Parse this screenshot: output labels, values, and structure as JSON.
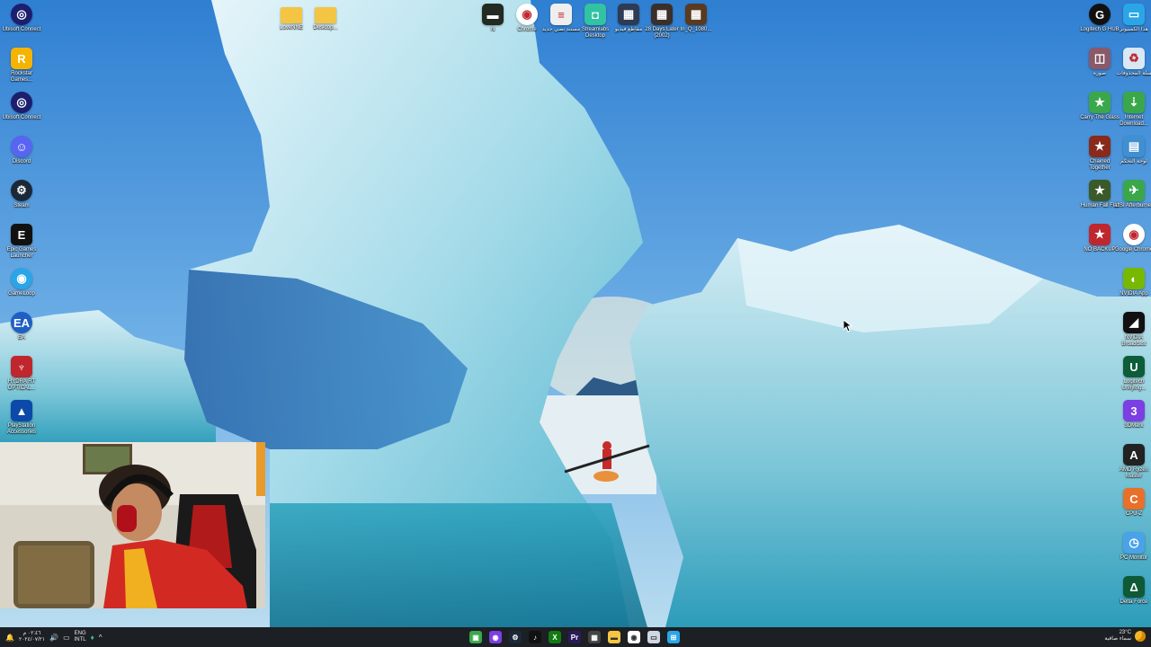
{
  "desktop": {
    "left_icons": [
      {
        "label": "Ubisoft Connect",
        "icon": "ubisoft-icon",
        "color": "#1b1f6e"
      },
      {
        "label": "Rockstar Games...",
        "icon": "rockstar-icon",
        "color": "#f4b400"
      },
      {
        "label": "Ubisoft Connect",
        "icon": "ubisoft-icon",
        "color": "#1b1f6e"
      },
      {
        "label": "Discord",
        "icon": "discord-icon",
        "color": "#5865f2"
      },
      {
        "label": "Steam",
        "icon": "steam-icon",
        "color": "#1b2838"
      },
      {
        "label": "Epic Games Launcher",
        "icon": "epic-games-icon",
        "color": "#111111"
      },
      {
        "label": "GameLoop",
        "icon": "gameloop-icon",
        "color": "#2aa6e8"
      },
      {
        "label": "EA",
        "icon": "ea-icon",
        "color": "#1f5fc4"
      },
      {
        "label": "HYDRA RT OPTICAL...",
        "icon": "hydra-icon",
        "color": "#c0262d"
      },
      {
        "label": "PlayStation Accessories",
        "icon": "playstation-icon",
        "color": "#0b4aa8"
      }
    ],
    "top_icons": [
      {
        "label": "LoveNNE",
        "icon": "folder-icon",
        "color": "#f4c542"
      },
      {
        "label": "Desktop...",
        "icon": "folder-icon",
        "color": "#f4c542"
      },
      {
        "label": "N",
        "icon": "battery-file-icon",
        "color": "#222a22"
      },
      {
        "label": "Chrome",
        "icon": "chrome-icon",
        "color": "#ffffff"
      },
      {
        "label": "مستند نصي جديد",
        "icon": "text-file-icon",
        "color": "#eeeeee"
      },
      {
        "label": "Streamlabs Desktop",
        "icon": "streamlabs-icon",
        "color": "#31c3a2"
      },
      {
        "label": "مقاطع فيديو",
        "icon": "video-file-icon",
        "color": "#2d3b55"
      },
      {
        "label": "28 Days Later (2002)",
        "icon": "video-file-icon",
        "color": "#3a2f2a"
      },
      {
        "label": "In_Q_1080...",
        "icon": "video-file-icon",
        "color": "#5a3b1f"
      }
    ],
    "right_col_outer": [
      {
        "label": "هذا الكمبيوتر",
        "icon": "monitor-icon",
        "color": "#2aa6e8"
      },
      {
        "label": "سلة المحذوفات",
        "icon": "recycle-bin-icon",
        "color": "#d8e8f5"
      },
      {
        "label": "Internet Download...",
        "icon": "idm-icon",
        "color": "#3aa84a"
      },
      {
        "label": "لوحة التحكم",
        "icon": "control-panel-icon",
        "color": "#3f8fd1"
      },
      {
        "label": "MSI Afterburner",
        "icon": "afterburner-icon",
        "color": "#3aa84a"
      },
      {
        "label": "Google Chrome",
        "icon": "chrome-icon",
        "color": "#ffffff"
      },
      {
        "label": "NVIDIA App",
        "icon": "nvidia-icon",
        "color": "#76b900"
      },
      {
        "label": "NVIDIA Broadcast",
        "icon": "nvidia-broadcast-icon",
        "color": "#111111"
      },
      {
        "label": "Logitech Unifying...",
        "icon": "logitech-icon",
        "color": "#0d5d3a"
      },
      {
        "label": "3DMark",
        "icon": "3dmark-icon",
        "color": "#7b3fe4"
      },
      {
        "label": "AMD Ryzen Master",
        "icon": "amd-icon",
        "color": "#222222"
      },
      {
        "label": "CPU-Z",
        "icon": "cpuz-icon",
        "color": "#e8702a"
      },
      {
        "label": "PC Monitor",
        "icon": "pc-monitor-icon",
        "color": "#4aa3e8"
      },
      {
        "label": "Delta Force",
        "icon": "delta-force-icon",
        "color": "#0f5a36"
      }
    ],
    "right_col_inner": [
      {
        "label": "Logitech G HUB",
        "icon": "logitech-g-icon",
        "color": "#111111"
      },
      {
        "label": "صورة",
        "icon": "photo-icon",
        "color": "#8a5a6a"
      },
      {
        "label": "Carry The Glass",
        "icon": "game-icon",
        "color": "#3aa84a"
      },
      {
        "label": "Chained Together",
        "icon": "game-icon",
        "color": "#8a2a1a"
      },
      {
        "label": "Human Fall Flat",
        "icon": "game-icon",
        "color": "#3b5a2a"
      },
      {
        "label": "NO BACKUP",
        "icon": "game-icon",
        "color": "#c0262d"
      }
    ]
  },
  "taskbar": {
    "clock_time": "٠٢:٤٦ م",
    "clock_date": "٢٠٢٤/٠٧/٢١",
    "lang_top": "ENG",
    "lang_bottom": "INTL",
    "weather_temp": "23°C",
    "weather_text": "سماء صافية",
    "apps": [
      {
        "icon": "task-view-icon",
        "color": "#3aa84a"
      },
      {
        "icon": "chat-icon",
        "color": "#7b3fe4"
      },
      {
        "icon": "steam-icon",
        "color": "#1b2838"
      },
      {
        "icon": "tiktok-icon",
        "color": "#111111"
      },
      {
        "icon": "xbox-icon",
        "color": "#107c10"
      },
      {
        "icon": "premiere-icon",
        "color": "#2a1a5a"
      },
      {
        "icon": "calculator-icon",
        "color": "#444444"
      },
      {
        "icon": "file-explorer-icon",
        "color": "#f4c542"
      },
      {
        "icon": "chrome-icon",
        "color": "#ffffff"
      },
      {
        "icon": "window-icon",
        "color": "#cfd8e3"
      },
      {
        "icon": "windows-start-icon",
        "color": "#2aa6e8"
      }
    ]
  }
}
